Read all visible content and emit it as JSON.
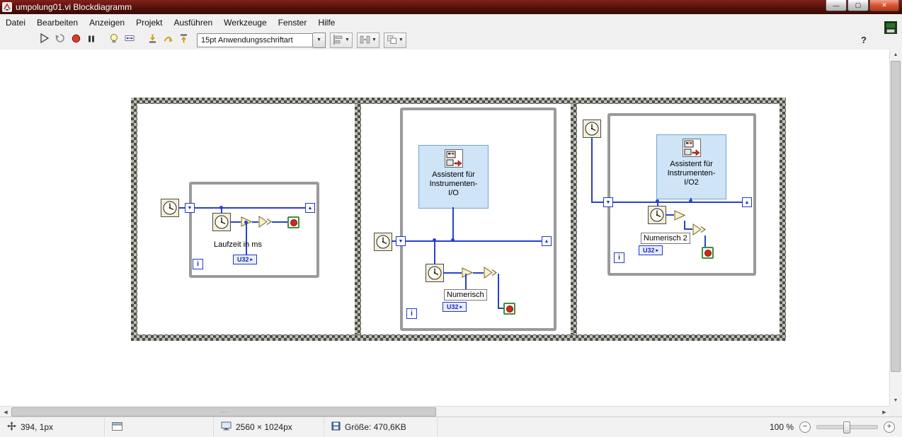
{
  "titlebar": {
    "title": "umpolung01.vi Blockdiagramm"
  },
  "window_controls": {
    "minimize": "—",
    "maximize": "▢",
    "close": "✕"
  },
  "menubar": {
    "items": [
      {
        "label": "Datei"
      },
      {
        "label": "Bearbeiten"
      },
      {
        "label": "Anzeigen"
      },
      {
        "label": "Projekt"
      },
      {
        "label": "Ausführen"
      },
      {
        "label": "Werkzeuge"
      },
      {
        "label": "Fenster"
      },
      {
        "label": "Hilfe"
      }
    ]
  },
  "toolbar": {
    "font_selector": "15pt Anwendungsschriftart",
    "help": "?"
  },
  "glyphs": {
    "dropdown": "▼",
    "tunnel_in": "▼",
    "tunnel_out": "▲",
    "terminal_arrow": "▸",
    "scroll_up": "▲",
    "scroll_down": "▼",
    "scroll_left": "◀",
    "scroll_right": "▶",
    "thumb_grip": "∙∙∙",
    "zoom_minus": "−",
    "zoom_plus": "+"
  },
  "diagram": {
    "frame1": {
      "runtime_label": "Laufzeit in ms",
      "u32": "U32",
      "iteration": "i"
    },
    "frame2": {
      "express_vi_lines": [
        "Assistent für",
        "Instrumenten-",
        "I/O"
      ],
      "numeric_label": "Numerisch",
      "u32": "U32",
      "iteration": "i"
    },
    "frame3": {
      "express_vi_lines": [
        "Assistent für",
        "Instrumenten-",
        "I/O2"
      ],
      "numeric_label": "Numerisch 2",
      "u32": "U32",
      "iteration": "i"
    }
  },
  "statusbar": {
    "cursor_position": "394, 1px",
    "resolution": "2560 × 1024px",
    "file_size": "Größe: 470,6KB",
    "zoom_level": "100 %"
  },
  "colors": {
    "wire_blue": "#2741cd",
    "loop_gray": "#9a9a9a",
    "express_bg": "#cfe4f7",
    "titlebar_red": "#50100a"
  }
}
